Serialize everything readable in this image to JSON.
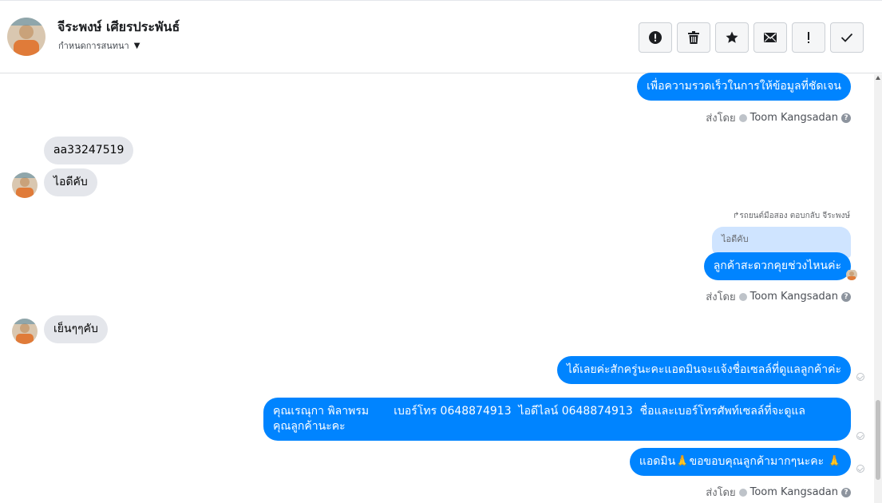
{
  "header": {
    "contact_name": "จีระพงษ์ เศียรประพันธ์",
    "conversation_menu": "กำหนดการสนทนา",
    "actions": [
      {
        "icon": "alert-circle-icon",
        "label": "mark-spam"
      },
      {
        "icon": "trash-icon",
        "label": "delete"
      },
      {
        "icon": "star-icon",
        "label": "star"
      },
      {
        "icon": "envelope-icon",
        "label": "mark-unread"
      },
      {
        "icon": "exclamation-icon",
        "label": "mark-important"
      },
      {
        "icon": "checkmark-icon",
        "label": "mark-done"
      }
    ]
  },
  "messages": {
    "m1": {
      "text": "เพื่อความรวดเร็วในการให้ข้อมูลที่ชัดเจน"
    },
    "sent_by_1": {
      "prefix": "ส่งโดย",
      "name": "Toom Kangsadan"
    },
    "m2": {
      "text": "aa33247519"
    },
    "m3": {
      "text": "ไอดีคับ"
    },
    "reply_label": "รถยนต์มือสอง ตอบกลับ จีระพงษ์",
    "quoted": {
      "text": "ไอดีคับ"
    },
    "m4": {
      "text": "ลูกค้าสะดวกคุยช่วงไหนค่ะ"
    },
    "sent_by_2": {
      "prefix": "ส่งโดย",
      "name": "Toom Kangsadan"
    },
    "m5": {
      "text": "เย็นๆๆคับ"
    },
    "m6": {
      "text": "ได้เลยค่ะสักครู่นะคะแอดมินจะแจ้งชื่อเซลล์ที่ดูแลลูกค้าค่ะ"
    },
    "m7": {
      "line1": "คุณเรณุกา พิลาพรม       เบอร์โทร 0648874913  ไอดีไลน์ 0648874913  ชื่อและเบอร์โทรศัพท์เซลล์ที่จะดูแล",
      "line2": "คุณลูกค้านะคะ"
    },
    "m8": {
      "text": "แอดมิน🙏ขอขอบคุณลูกค้ามากๆนะคะ 🙏"
    },
    "sent_by_3": {
      "prefix": "ส่งโดย",
      "name": "Toom Kangsadan"
    }
  },
  "colors": {
    "outgoing_bubble": "#0084ff",
    "incoming_bubble": "#e4e6eb",
    "quote_bubble": "#cfe4ff"
  }
}
